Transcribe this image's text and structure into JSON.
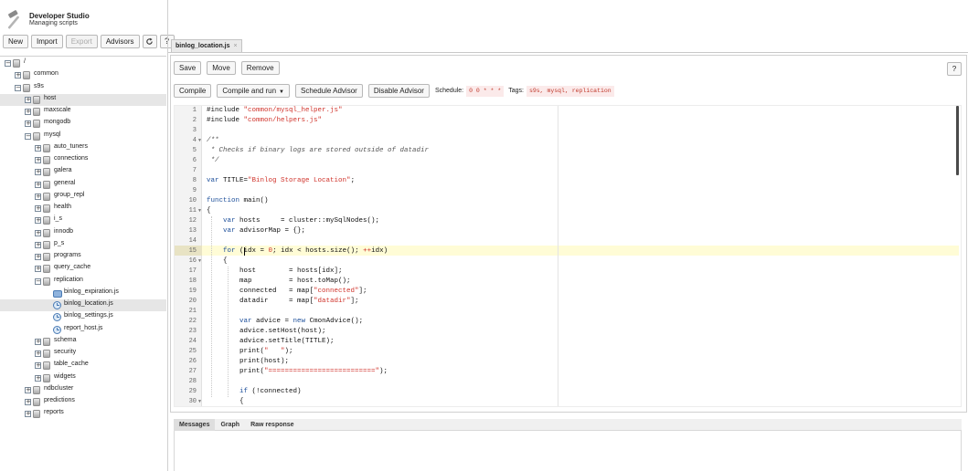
{
  "app": {
    "title": "Developer Studio",
    "subtitle": "Managing scripts",
    "logo_icon": "hammer-icon"
  },
  "toolbar": {
    "new": "New",
    "import": "Import",
    "export": "Export",
    "advisors": "Advisors",
    "refresh_icon": "refresh-icon",
    "help": "?"
  },
  "tree": [
    {
      "label": "/",
      "depth": 0,
      "type": "folder",
      "expanded": true
    },
    {
      "label": "common",
      "depth": 1,
      "type": "folder",
      "expanded": false
    },
    {
      "label": "s9s",
      "depth": 1,
      "type": "folder",
      "expanded": true
    },
    {
      "label": "host",
      "depth": 2,
      "type": "folder",
      "expanded": false,
      "selected": true
    },
    {
      "label": "maxscale",
      "depth": 2,
      "type": "folder",
      "expanded": false
    },
    {
      "label": "mongodb",
      "depth": 2,
      "type": "folder",
      "expanded": false
    },
    {
      "label": "mysql",
      "depth": 2,
      "type": "folder",
      "expanded": true
    },
    {
      "label": "auto_tuners",
      "depth": 3,
      "type": "folder",
      "expanded": false
    },
    {
      "label": "connections",
      "depth": 3,
      "type": "folder",
      "expanded": false
    },
    {
      "label": "galera",
      "depth": 3,
      "type": "folder",
      "expanded": false
    },
    {
      "label": "general",
      "depth": 3,
      "type": "folder",
      "expanded": false
    },
    {
      "label": "group_repl",
      "depth": 3,
      "type": "folder",
      "expanded": false
    },
    {
      "label": "health",
      "depth": 3,
      "type": "folder",
      "expanded": false
    },
    {
      "label": "i_s",
      "depth": 3,
      "type": "folder",
      "expanded": false
    },
    {
      "label": "innodb",
      "depth": 3,
      "type": "folder",
      "expanded": false
    },
    {
      "label": "p_s",
      "depth": 3,
      "type": "folder",
      "expanded": false
    },
    {
      "label": "programs",
      "depth": 3,
      "type": "folder",
      "expanded": false
    },
    {
      "label": "query_cache",
      "depth": 3,
      "type": "folder",
      "expanded": false
    },
    {
      "label": "replication",
      "depth": 3,
      "type": "folder",
      "expanded": true
    },
    {
      "label": "binlog_expiration.js",
      "depth": 4,
      "type": "file-blue"
    },
    {
      "label": "binlog_location.js",
      "depth": 4,
      "type": "file",
      "selected": true
    },
    {
      "label": "binlog_settings.js",
      "depth": 4,
      "type": "file"
    },
    {
      "label": "report_host.js",
      "depth": 4,
      "type": "file"
    },
    {
      "label": "schema",
      "depth": 3,
      "type": "folder",
      "expanded": false
    },
    {
      "label": "security",
      "depth": 3,
      "type": "folder",
      "expanded": false
    },
    {
      "label": "table_cache",
      "depth": 3,
      "type": "folder",
      "expanded": false
    },
    {
      "label": "widgets",
      "depth": 3,
      "type": "folder",
      "expanded": false
    },
    {
      "label": "ndbcluster",
      "depth": 2,
      "type": "folder",
      "expanded": false
    },
    {
      "label": "predictions",
      "depth": 2,
      "type": "folder",
      "expanded": false
    },
    {
      "label": "reports",
      "depth": 2,
      "type": "folder",
      "expanded": false
    }
  ],
  "file_tab": {
    "label": "binlog_location.js",
    "close": "×"
  },
  "editor_toolbar": {
    "save": "Save",
    "move": "Move",
    "remove": "Remove",
    "help": "?"
  },
  "run_toolbar": {
    "compile": "Compile",
    "compile_and_run": "Compile and run",
    "schedule_advisor": "Schedule Advisor",
    "disable_advisor": "Disable Advisor",
    "schedule_label": "Schedule:",
    "schedule_value": "0 0 * * *",
    "tags_label": "Tags:",
    "tags_value": "s9s, mysql, replication"
  },
  "editor": {
    "active_line": 15,
    "lines": [
      {
        "n": "1",
        "code": "#include \"common/mysql_helper.js\""
      },
      {
        "n": "2",
        "code": "#include \"common/helpers.js\""
      },
      {
        "n": "3",
        "code": ""
      },
      {
        "n": "4",
        "code": "/**",
        "fold": true
      },
      {
        "n": "5",
        "code": " * Checks if binary logs are stored outside of datadir"
      },
      {
        "n": "6",
        "code": " */"
      },
      {
        "n": "7",
        "code": ""
      },
      {
        "n": "8",
        "code": "var TITLE=\"Binlog Storage Location\";"
      },
      {
        "n": "9",
        "code": ""
      },
      {
        "n": "10",
        "code": "function main()"
      },
      {
        "n": "11",
        "code": "{",
        "fold": true
      },
      {
        "n": "12",
        "code": "    var hosts     = cluster::mySqlNodes();"
      },
      {
        "n": "13",
        "code": "    var advisorMap = {};"
      },
      {
        "n": "14",
        "code": ""
      },
      {
        "n": "15",
        "code": "    for (idx = 0; idx < hosts.size(); ++idx)"
      },
      {
        "n": "16",
        "code": "    {",
        "fold": true
      },
      {
        "n": "17",
        "code": "        host        = hosts[idx];"
      },
      {
        "n": "18",
        "code": "        map         = host.toMap();"
      },
      {
        "n": "19",
        "code": "        connected   = map[\"connected\"];"
      },
      {
        "n": "20",
        "code": "        datadir     = map[\"datadir\"];"
      },
      {
        "n": "21",
        "code": ""
      },
      {
        "n": "22",
        "code": "        var advice = new CmonAdvice();"
      },
      {
        "n": "23",
        "code": "        advice.setHost(host);"
      },
      {
        "n": "24",
        "code": "        advice.setTitle(TITLE);"
      },
      {
        "n": "25",
        "code": "        print(\"   \");"
      },
      {
        "n": "26",
        "code": "        print(host);"
      },
      {
        "n": "27",
        "code": "        print(\"==========================\");"
      },
      {
        "n": "28",
        "code": ""
      },
      {
        "n": "29",
        "code": "        if (!connected)"
      },
      {
        "n": "30",
        "code": "        {",
        "fold": true
      }
    ]
  },
  "bottom_tabs": [
    {
      "label": "Messages",
      "active": true
    },
    {
      "label": "Graph",
      "active": false
    },
    {
      "label": "Raw response",
      "active": false
    }
  ]
}
